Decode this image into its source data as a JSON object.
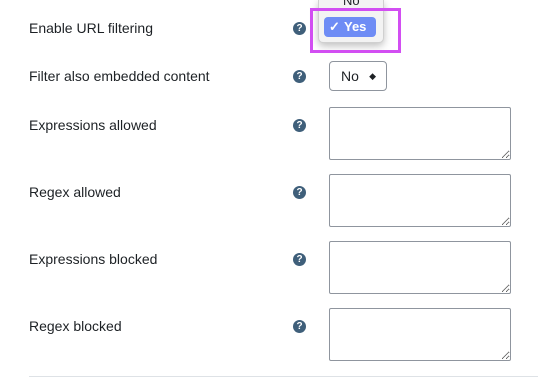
{
  "form": {
    "rows": [
      {
        "label": "Enable URL filtering"
      },
      {
        "label": "Filter also embedded content",
        "select_value": "No"
      },
      {
        "label": "Expressions allowed",
        "value": ""
      },
      {
        "label": "Regex allowed",
        "value": ""
      },
      {
        "label": "Expressions blocked",
        "value": ""
      },
      {
        "label": "Regex blocked",
        "value": ""
      }
    ],
    "help_glyph": "?"
  },
  "dropdown": {
    "options": [
      "No",
      "Yes"
    ],
    "selected": "Yes",
    "check_glyph": "✓"
  },
  "select_caret": "◆",
  "colors": {
    "help_icon": "#3f5f7a",
    "selected_option": "#6e8cf5",
    "highlight_border": "#d24ef2",
    "field_border": "#8f959e"
  }
}
